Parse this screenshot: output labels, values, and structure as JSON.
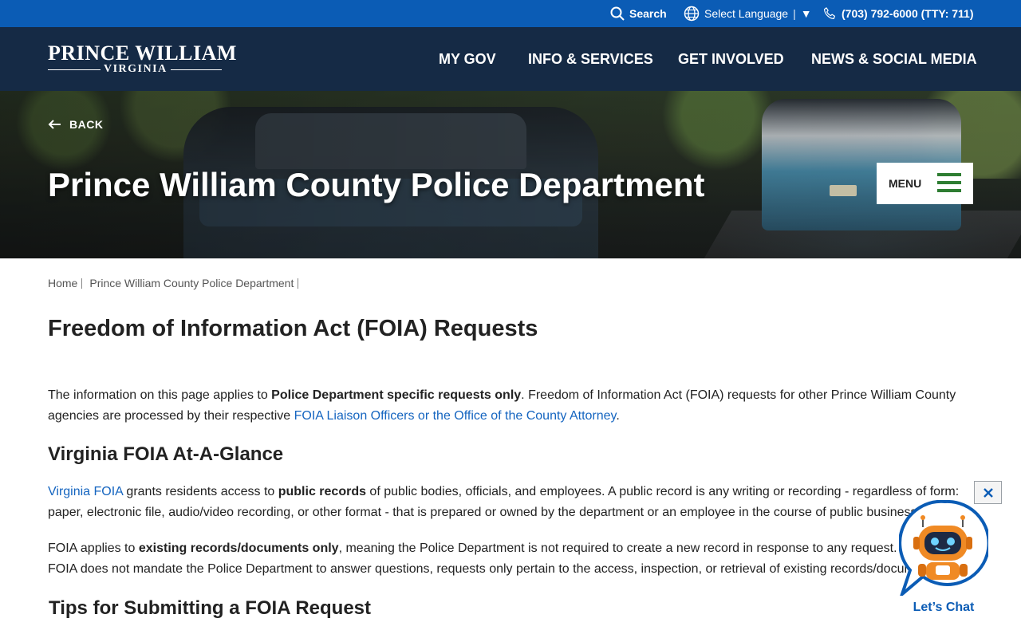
{
  "utility_bar": {
    "search_label": "Search",
    "language_label": "Select Language",
    "language_arrow": "▼",
    "phone_label": "(703) 792-6000 (TTY: 711)",
    "bg_color": "#0b5cb5"
  },
  "header": {
    "logo_top": "PRINCE WILLIAM",
    "logo_bottom": "VIRGINIA",
    "nav": [
      {
        "label": "MY GOV"
      },
      {
        "label": "INFO & SERVICES"
      },
      {
        "label": "GET INVOLVED"
      },
      {
        "label": "NEWS & SOCIAL MEDIA"
      }
    ],
    "bg_color": "#152a45"
  },
  "hero": {
    "back_label": "BACK",
    "title": "Prince William County Police Department",
    "menu_label": "MENU",
    "menu_icon_color": "#2e7d32"
  },
  "breadcrumb": {
    "items": [
      {
        "label": "Home"
      },
      {
        "label": "Prince William County Police Department"
      }
    ]
  },
  "content": {
    "title": "Freedom of Information Act (FOIA) Requests",
    "intro": {
      "t1": "The information on this page applies to ",
      "bold1": "Police Department specific requests only",
      "t2": ". Freedom of Information Act (FOIA) requests for other Prince William County agencies are processed by their respective ",
      "link1": "FOIA Liaison Officers or the Office of the County Attorney",
      "t3": "."
    },
    "section1_heading": "Virginia FOIA At-A-Glance",
    "para2": {
      "link": "Virginia FOIA",
      "t1": " grants residents access to ",
      "bold": "public records",
      "t2": " of public bodies, officials, and employees. A public record is any writing or recording - regardless of form: paper, electronic file, audio/video recording, or other format - that is prepared or owned by the department or an employee in the course of public business."
    },
    "para3": {
      "t1": "FOIA applies to ",
      "bold": "existing records/documents only",
      "t2": ", meaning the Police Department is not required to create a new record in response to any request. Additionally, FOIA does not mandate the Police Department to answer questions, requests only pertain to the access, inspection, or retrieval of existing records/documents."
    },
    "section2_heading": "Tips for Submitting a FOIA Request"
  },
  "chat": {
    "label": "Let’s Chat",
    "close_glyph": "✕",
    "accent": "#0b5cb5",
    "robot_color": "#f08a24"
  }
}
